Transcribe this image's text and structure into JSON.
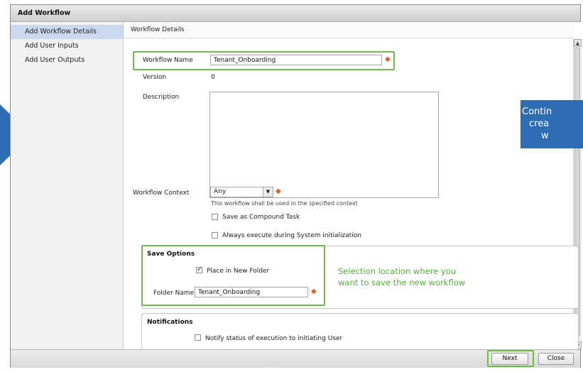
{
  "dialog": {
    "title": "Add Workflow"
  },
  "sidebar": {
    "items": [
      {
        "label": "Add Workflow Details",
        "active": true
      },
      {
        "label": "Add User Inputs",
        "active": false
      },
      {
        "label": "Add User Outputs",
        "active": false
      }
    ]
  },
  "main": {
    "header": "Workflow Details"
  },
  "form": {
    "workflow_name_label": "Workflow Name",
    "workflow_name_value": "Tenant_Onboarding",
    "version_label": "Version",
    "version_value": "0",
    "description_label": "Description",
    "description_value": "",
    "context_label": "Workflow Context",
    "context_value": "Any",
    "context_help": "This workflow shall be used in the specified context",
    "compound_task_label": "Save as Compound Task",
    "compound_task_checked": false,
    "always_execute_label": "Always execute during System initialization",
    "always_execute_checked": false
  },
  "save_options": {
    "title": "Save Options",
    "place_in_new_folder_label": "Place in New Folder",
    "place_in_new_folder_checked": true,
    "folder_name_label": "Folder Name",
    "folder_name_value": "Tenant_Onboarding"
  },
  "notifications": {
    "title": "Notifications",
    "notify_label": "Notify status of execution to initiating User",
    "notify_checked": false
  },
  "footer": {
    "next_label": "Next",
    "close_label": "Close"
  },
  "annotation": {
    "line1": "Selection location where you",
    "line2": "want to save the new workflow"
  },
  "callout": {
    "line1": "Contin",
    "line2": "crea",
    "line3": "w"
  },
  "icons": {
    "required": "required-asterisk-icon",
    "dropdown": "chevron-down-icon",
    "check": "checkmark-icon"
  },
  "colors": {
    "highlight": "#6fbd48",
    "annotation": "#53b13b",
    "callout": "#2e6db4",
    "required": "#e85d22",
    "sidebar_active": "#c9daf0"
  }
}
